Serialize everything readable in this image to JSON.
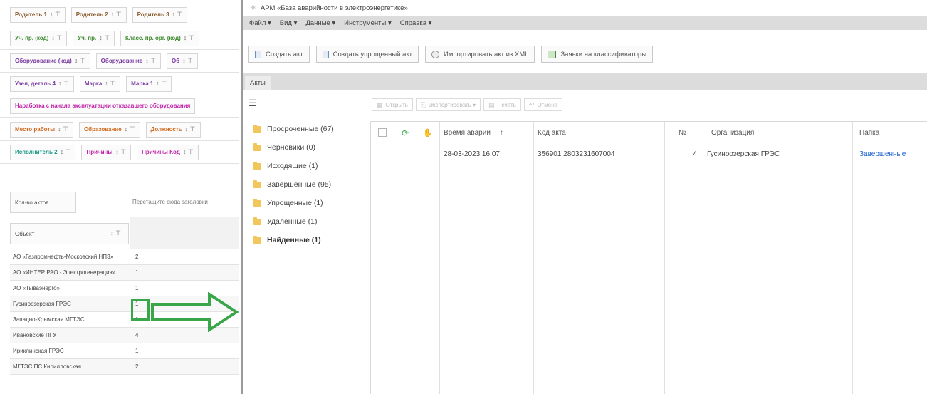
{
  "pivot": {
    "filter_rows": [
      [
        {
          "label": "Родитель 1",
          "color": "brown"
        },
        {
          "label": "Родитель 2",
          "color": "brown"
        },
        {
          "label": "Родитель 3",
          "color": "brown"
        }
      ],
      [
        {
          "label": "Уч. пр. (код)",
          "color": "green"
        },
        {
          "label": "Уч. пр.",
          "color": "green"
        },
        {
          "label": "Класс. пр. орг. (код)",
          "color": "green"
        }
      ],
      [
        {
          "label": "Оборудование (код)",
          "color": "purple"
        },
        {
          "label": "Оборудование",
          "color": "purple"
        },
        {
          "label": "Об",
          "color": "purple"
        }
      ],
      [
        {
          "label": "Узел, деталь 4",
          "color": "purple"
        },
        {
          "label": "Марка",
          "color": "purple"
        },
        {
          "label": "Марка 1",
          "color": "purple"
        }
      ],
      [
        {
          "label": "Наработка с начала эксплуатации отказавшего оборудования",
          "color": "magenta",
          "no_icons": true
        }
      ],
      [
        {
          "label": "Место работы",
          "color": "orange"
        },
        {
          "label": "Образование",
          "color": "orange"
        },
        {
          "label": "Должность",
          "color": "orange"
        }
      ],
      [
        {
          "label": "Исполнитель 2",
          "color": "teal"
        },
        {
          "label": "Причины",
          "color": "magenta"
        },
        {
          "label": "Причины Код",
          "color": "magenta"
        }
      ]
    ],
    "count_label": "Кол-во актов",
    "drag_hint": "Перетащите сюда заголовки",
    "object_header": "Объект",
    "objects": [
      {
        "name": "АО «Газпромнефть-Московский НПЗ»",
        "count": "2"
      },
      {
        "name": "АО «ИНТЕР РАО - Электрогенерация»",
        "count": "1"
      },
      {
        "name": "АО «Тываэнерго»",
        "count": "1"
      },
      {
        "name": "Гусиноозерская ГРЭС",
        "count": "1"
      },
      {
        "name": "Западно-Крымская МГТЭС",
        "count": "1"
      },
      {
        "name": "Ивановские ПГУ",
        "count": "4"
      },
      {
        "name": "Ириклинская ГРЭС",
        "count": "1"
      },
      {
        "name": "МГТЭС ПС Кирилловская",
        "count": "2"
      }
    ]
  },
  "app": {
    "title": "АРМ «База аварийности в электроэнергетике»",
    "menu": [
      "Файл ▾",
      "Вид ▾",
      "Данные ▾",
      "Инструменты ▾",
      "Справка ▾"
    ],
    "toolbar": {
      "create_act": "Создать акт",
      "create_simple_act": "Создать упрощенный акт",
      "import_xml": "Импортировать акт из XML",
      "classifier_requests": "Заявки на классификаторы"
    },
    "tab": "Акты",
    "folders": [
      {
        "label": "Просроченные (67)",
        "active": false
      },
      {
        "label": "Черновики (0)",
        "active": false
      },
      {
        "label": "Исходящие (1)",
        "active": false
      },
      {
        "label": "Завершенные (95)",
        "active": false
      },
      {
        "label": "Упрощенные (1)",
        "active": false
      },
      {
        "label": "Удаленные (1)",
        "active": false
      },
      {
        "label": "Найденные (1)",
        "active": true
      }
    ],
    "grid_toolbar": {
      "open": "Открыть",
      "export": "Экспортировать ▾",
      "print": "Печать",
      "cancel": "Отмена"
    },
    "grid": {
      "columns": {
        "time": "Время аварии",
        "code": "Код акта",
        "num": "№",
        "org": "Организация",
        "folder": "Папка"
      },
      "rows": [
        {
          "time": "28-03-2023 16:07",
          "code": "356901 2803231607004",
          "num": "4",
          "org": "Гусиноозерская ГРЭС",
          "folder": "Завершенные"
        }
      ]
    },
    "colors": {
      "accent_green": "#3aa64a",
      "menubar_gray": "#dcdcdc",
      "link_blue": "#1a5fcf"
    }
  }
}
